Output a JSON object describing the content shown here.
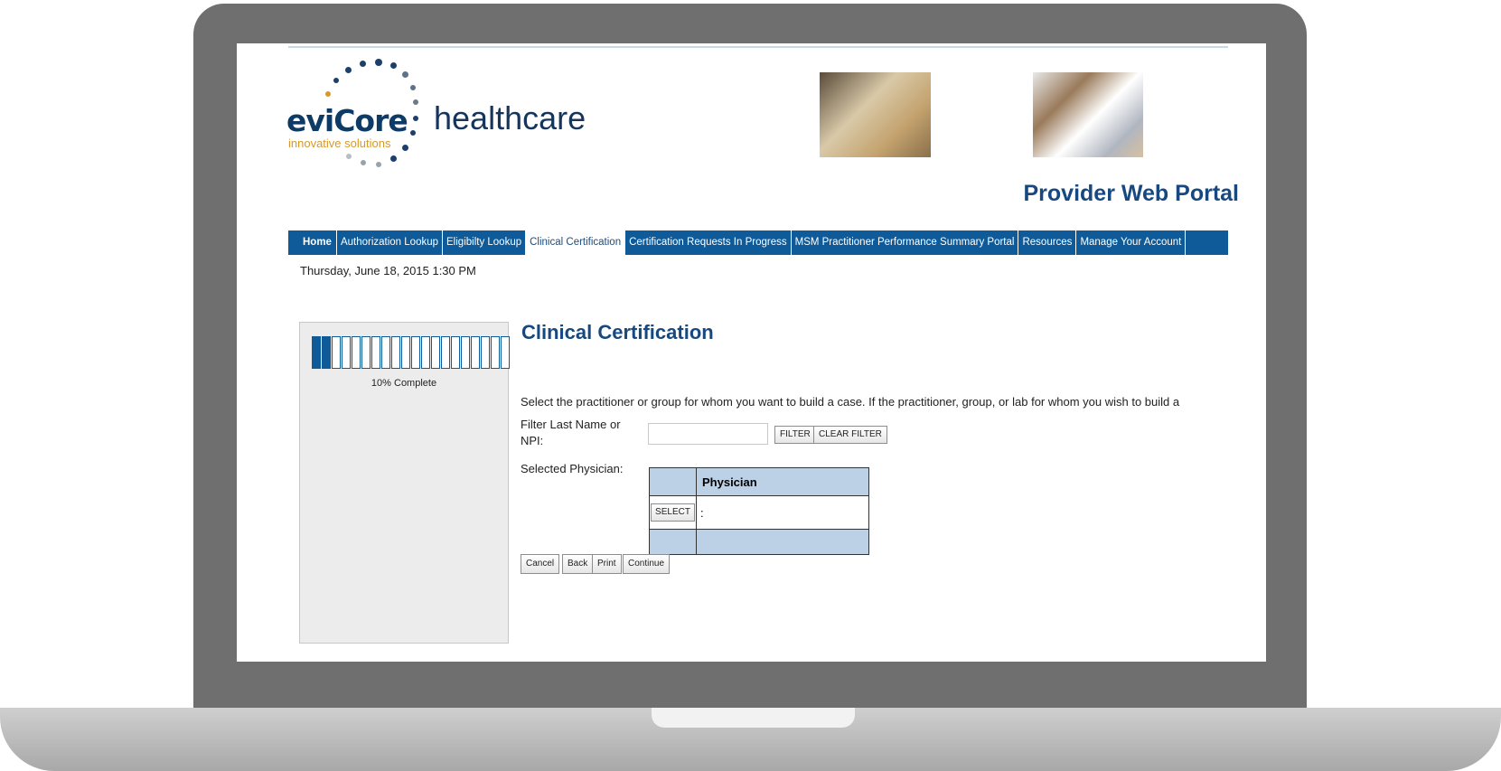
{
  "header": {
    "logo": {
      "brand": "eviCore",
      "suffix": "healthcare",
      "tagline": "innovative solutions"
    },
    "portal_title": "Provider Web Portal"
  },
  "nav": {
    "items": [
      {
        "label": "Home",
        "active": false
      },
      {
        "label": "Authorization Lookup",
        "active": false
      },
      {
        "label": "Eligibilty Lookup",
        "active": false
      },
      {
        "label": "Clinical Certification",
        "active": true
      },
      {
        "label": "Certification Requests In Progress",
        "active": false
      },
      {
        "label": "MSM Practitioner Performance Summary Portal",
        "active": false
      },
      {
        "label": "Resources",
        "active": false
      },
      {
        "label": "Manage Your Account",
        "active": false
      }
    ]
  },
  "datetime": "Thursday, June 18, 2015 1:30 PM",
  "progress": {
    "percent": 10,
    "label": "10% Complete",
    "total_segments": 20,
    "filled_segments": 2
  },
  "main": {
    "heading": "Clinical Certification",
    "instructions": "Select the practitioner or group for whom you want to build a case. If the practitioner, group, or lab for whom you wish to build a",
    "filter": {
      "label": "Filter Last Name or NPI:",
      "value": "",
      "filter_button": "FILTER",
      "clear_button": "CLEAR FILTER"
    },
    "selected_physician_label": "Selected Physician:",
    "table": {
      "header": "Physician",
      "rows": [
        {
          "button": "SELECT",
          "name": ":"
        }
      ]
    },
    "actions": {
      "cancel": "Cancel",
      "back": "Back",
      "print": "Print",
      "continue": "Continue"
    }
  },
  "colors": {
    "brand_blue": "#0f5a98",
    "title_blue": "#17487f",
    "table_header_bg": "#bcd0e6",
    "logo_gold": "#d59a2b"
  }
}
